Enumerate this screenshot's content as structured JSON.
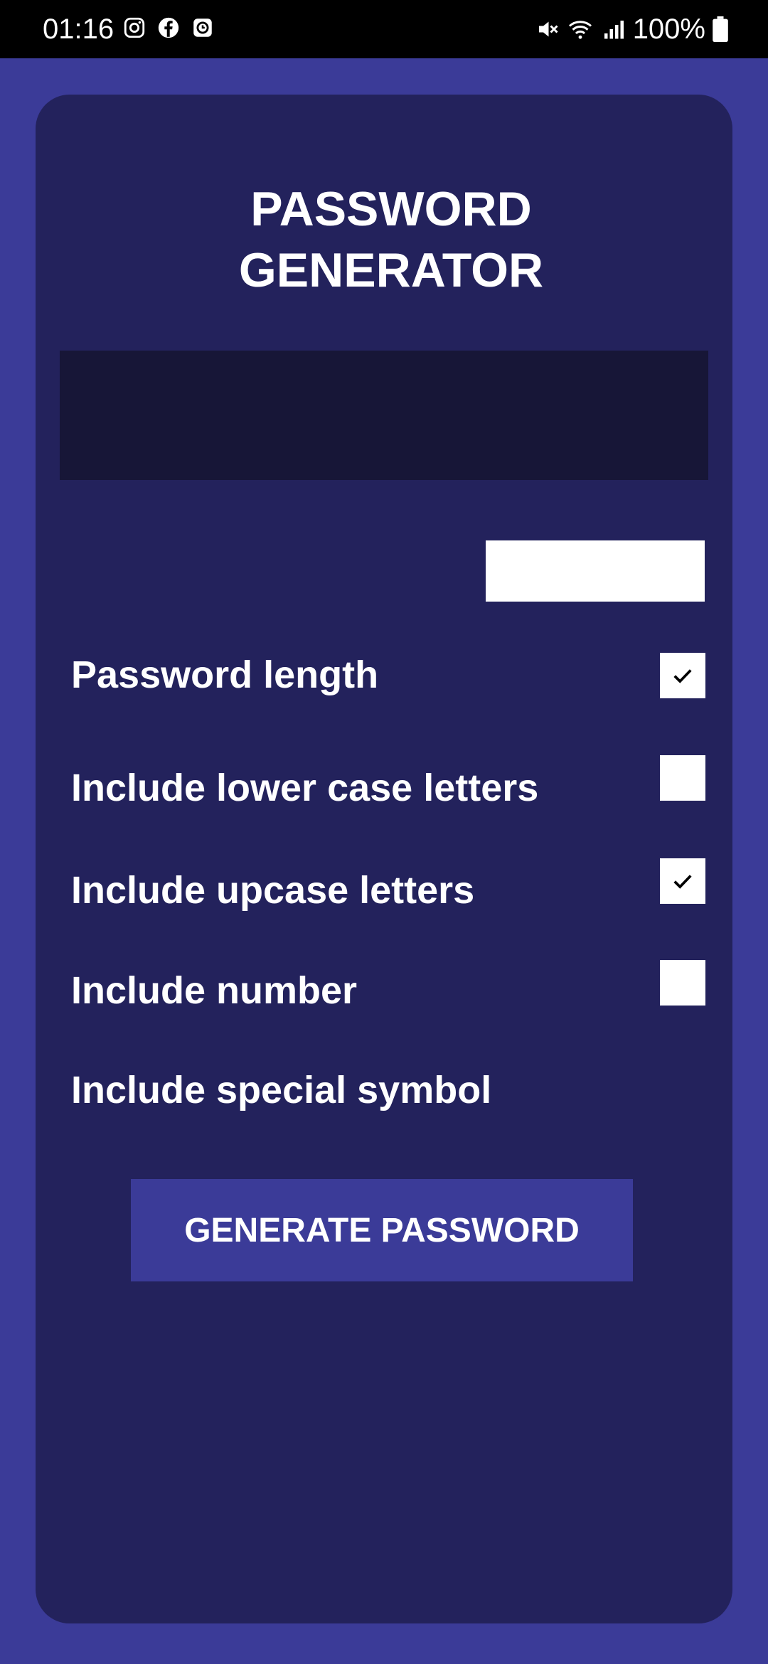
{
  "status_bar": {
    "time": "01:16",
    "notification_icons": [
      "instagram-icon",
      "facebook-icon",
      "clock-app-icon"
    ],
    "system_icons": [
      "mute-icon",
      "wifi-icon",
      "signal-icon"
    ],
    "battery_percent": "100%"
  },
  "app": {
    "title_line1": "PASSWORD",
    "title_line2": "GENERATOR",
    "generated_password": ""
  },
  "form": {
    "length_label": "Password length",
    "length_value": "",
    "options": [
      {
        "label": "Include lower case letters",
        "checked": true
      },
      {
        "label": "Include upcase letters",
        "checked": false
      },
      {
        "label": "Include number",
        "checked": true
      },
      {
        "label": "Include special symbol",
        "checked": false
      }
    ],
    "generate_label": "GENERATE PASSWORD"
  },
  "colors": {
    "background": "#3b3b98",
    "card": "#23225c",
    "output_box": "#171637",
    "button": "#3b3b98",
    "text": "#ffffff"
  }
}
